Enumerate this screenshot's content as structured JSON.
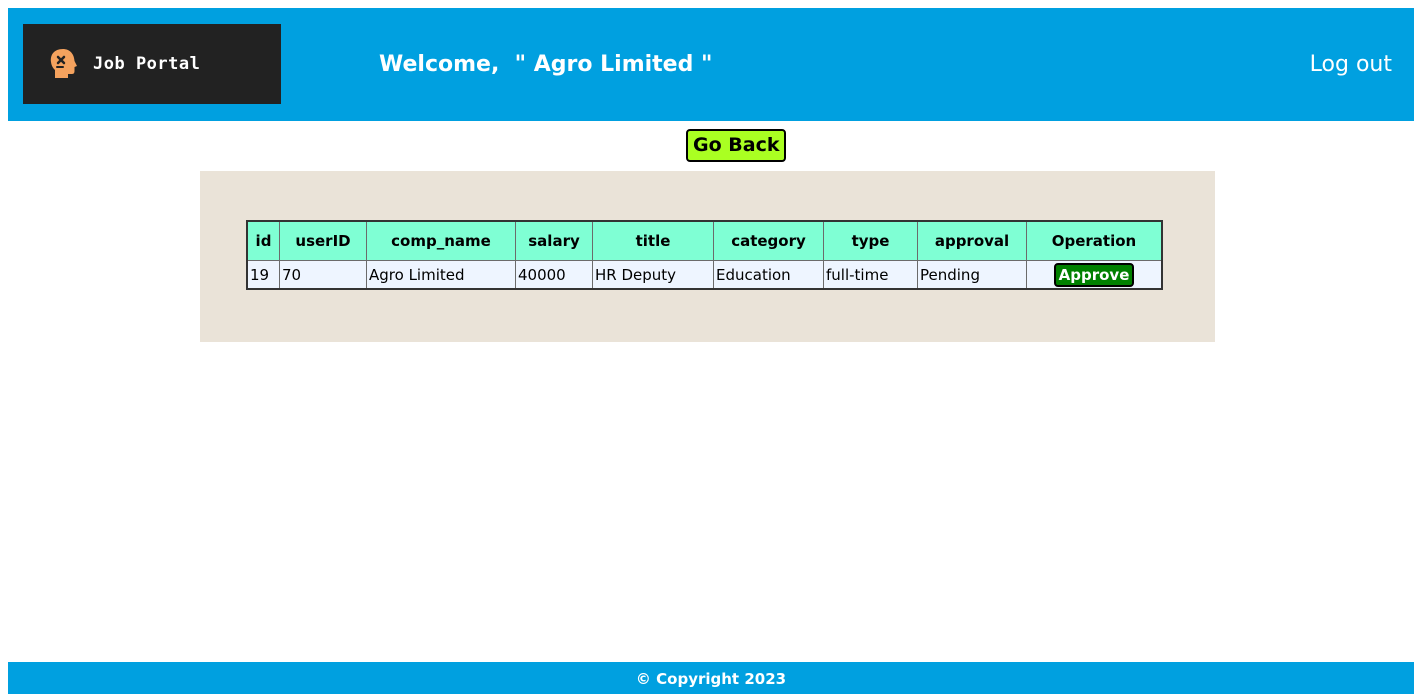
{
  "header": {
    "logo_text": "Job Portal",
    "welcome_text": "Welcome,  \" Agro Limited \"",
    "logout_label": "Log out"
  },
  "actions": {
    "go_back_label": "Go Back"
  },
  "table": {
    "columns": [
      "id",
      "userID",
      "comp_name",
      "salary",
      "title",
      "category",
      "type",
      "approval",
      "Operation"
    ],
    "rows": [
      {
        "id": "19",
        "userID": "70",
        "comp_name": "Agro Limited",
        "salary": "40000",
        "title": "HR Deputy",
        "category": "Education",
        "type": "full-time",
        "approval": "Pending",
        "operation_label": "Approve"
      }
    ]
  },
  "footer": {
    "copyright": "© Copyright 2023"
  },
  "colors": {
    "header_bg": "#00a0e0",
    "panel_bg": "#eae3d8",
    "table_header_bg": "#7fffd4",
    "go_back_bg": "#aaff22",
    "approve_bg": "#008000"
  },
  "icons": {
    "logo": "thinking-head-icon"
  }
}
